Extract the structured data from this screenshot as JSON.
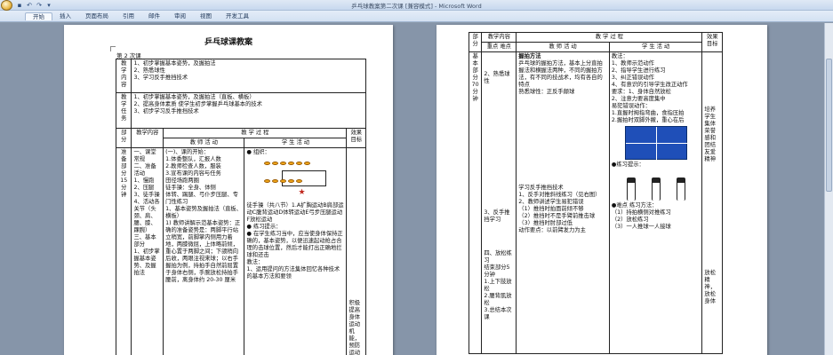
{
  "window": {
    "title": "乒乓球教案第二次课 [兼容模式] - Microsoft Word"
  },
  "ribbon": {
    "tabs": [
      "开始",
      "插入",
      "页面布局",
      "引用",
      "邮件",
      "审阅",
      "视图",
      "开发工具"
    ]
  },
  "left_page": {
    "title": "乒乓球课教案",
    "period": "第 2 次课",
    "content_label": "教学内容",
    "content_items": [
      "1、初步掌握基本姿势，及握拍法",
      "2、熟悉球性",
      "3、学习反手推挡技术"
    ],
    "task_label": "教学任务",
    "task_items": [
      "1、初步掌握基本姿势，及握拍法（直板、横板）",
      "2、提高身体素质 使学生初步掌握乒乓球基本的技术",
      "3、初步学习反手推挡技术"
    ],
    "part_label": "部分",
    "teach_content_label": "教学内容",
    "process_label": "教 学 过 程",
    "teacher_label": "教 师 活 动",
    "student_label": "学 生 活 动",
    "effect_label": "效果目标",
    "prep_part": "准备部分15分钟",
    "prep_items": [
      "一、课堂常规",
      "二、准备活动",
      "1、慢跑",
      "2、压腿",
      "3、徒手操",
      "4、活动各关节（头颈、肩、腰、膝、踝腕）",
      "三、基本部分",
      "1、初步掌握基本姿势、及握拍法"
    ],
    "teacher_items": [
      "(一)、课的开始：",
      "1.体委整队，汇报人数",
      "2.教师检查人数，服装",
      "3.宣布课的内容与任务",
      "田径场跑两圈",
      "徒手操：全身、体侧",
      "体转、踢腿、弓仆步压腿、专门性练习",
      "1、基本姿势及握拍法（直板、横板）",
      "1) 教师讲解示范基本姿势：正确的准备姿势是：两脚平行站立稍宽，前脚掌内侧用力着地，两膝微屈，上体略前倾，重心置于两脚之间；下颌稍向后收，两眼注视来球；以右手握拍为例，持拍手自然前屈置于身体右侧，手腕放松持拍手腰前，离身体约 20-30 厘米"
    ],
    "student_items": [
      "● 组织：",
      "徒手操（共八节）1.A扩胸运动B肩部运动C腹背运动D体转运动E弓步压腿运动F放松运动",
      "● 练习提示：",
      "● 在学生练习当中，应当使身体保持正确的，基本姿势，以便迅速起动抢占合理的击球位置，然后才能打出正确地拦球和还击",
      "教法：",
      "1、运用提问的方法集体回忆各种技术的基本方法和要领"
    ],
    "effect_items": [
      "积极提高身体运动机能，预防运动伤病"
    ]
  },
  "right_page": {
    "part_label": "部分",
    "teach_content_label": "教学内容",
    "key_label": "重点 难点",
    "process_label": "教 学 过 程",
    "teacher_label": "教 师 活 动",
    "student_label": "学 生 活 动",
    "effect_label": "效果目标",
    "base_part": "基本部分70分钟",
    "content_items": [
      "2、熟悉球性",
      "3、反手推挡学习",
      "四、放松练习",
      "结束部分5分钟",
      "1.上下肢放松",
      "2.腰背肌放松",
      "3.总结本次课"
    ],
    "teacher_items": [
      "握拍方法",
      "乒乓球的握拍方法，基本上分直拍握法和横握法两种，不同的握拍方法，有不同的技战术，均有各自的特点",
      "熟悉球性：正反手颠球",
      "学习反手推挡技术",
      "1、反手对推斜线练习（见右图）",
      "2、教师讲述学生易犯错误",
      "（1）推挡时拍面前倾不够",
      "（2）推挡时不是手臂前推击球",
      "（3）推挡时肘部过低",
      "动作要点：以前臂发力为主"
    ],
    "student_items": [
      "教法：",
      "1、教师示范动作",
      "2、指导学生进行练习",
      "3、纠正错误动作",
      "4、有意识的引导学生改正动作",
      "要求：1、身体自然放松",
      "2、注意力要高度集中",
      "易犯错误动作：",
      "1.直握时拇指弯曲，食指压拍",
      "2.握拍时双脚外撇，重心在后",
      "●练习提示：",
      "●难点 练习方法：",
      "（1）持拍横侧对推练习",
      "（2）放松练习",
      "（3）一人推球一人接球"
    ],
    "effect_items": [
      "培养学生集体荣誉感和团结友爱精神",
      "放松精神，放松身体"
    ]
  }
}
